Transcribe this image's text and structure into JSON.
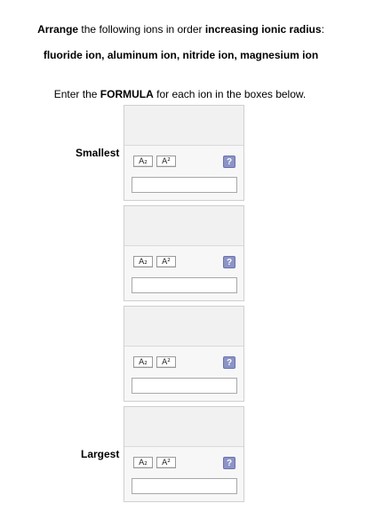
{
  "question": {
    "line1_bold1": "Arrange",
    "line1_text1": " the following ions in order ",
    "line1_bold2": "increasing ionic radius",
    "line1_text2": ":",
    "ions": "fluoride ion, aluminum ion, nitride ion, magnesium ion",
    "line3_text1": "Enter the ",
    "line3_bold": "FORMULA",
    "line3_text2": " for each ion in the boxes below."
  },
  "labels": {
    "smallest": "Smallest",
    "largest": "Largest"
  },
  "answers": [
    {
      "subscript_label": "A₂",
      "superscript_label": "A²",
      "help_label": "?",
      "value": ""
    },
    {
      "subscript_label": "A₂",
      "superscript_label": "A²",
      "help_label": "?",
      "value": ""
    },
    {
      "subscript_label": "A₂",
      "superscript_label": "A²",
      "help_label": "?",
      "value": ""
    },
    {
      "subscript_label": "A₂",
      "superscript_label": "A²",
      "help_label": "?",
      "value": ""
    }
  ]
}
